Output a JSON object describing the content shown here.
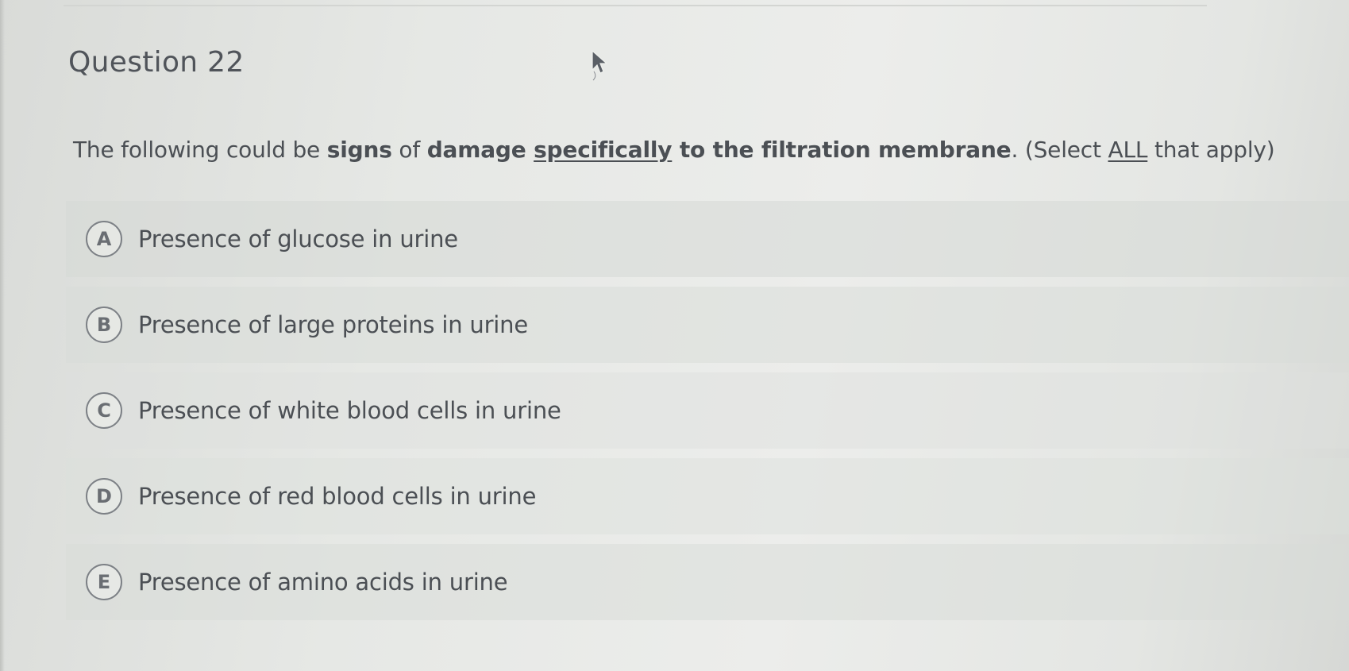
{
  "question": {
    "title": "Question 22",
    "prompt_parts": {
      "p1": "The following could be ",
      "p2": "signs",
      "p3": " of ",
      "p4": "damage ",
      "p5": "specifically",
      "p6": " to the filtration membrane",
      "p7": ". (Select ",
      "p8": "ALL",
      "p9": " that apply)"
    },
    "options": [
      {
        "letter": "A",
        "text": "Presence of glucose in urine"
      },
      {
        "letter": "B",
        "text": "Presence of large proteins in urine"
      },
      {
        "letter": "C",
        "text": "Presence of white blood cells in urine"
      },
      {
        "letter": "D",
        "text": "Presence of red blood cells in urine"
      },
      {
        "letter": "E",
        "text": "Presence of amino acids in urine"
      }
    ]
  },
  "icons": {
    "cursor": "mouse-pointer-icon"
  }
}
